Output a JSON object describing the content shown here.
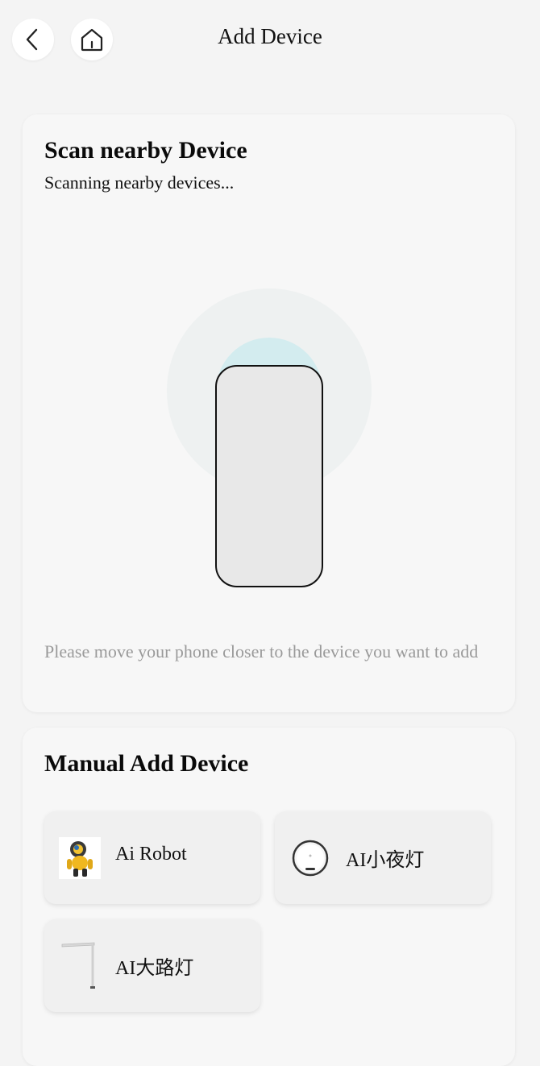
{
  "header": {
    "title": "Add Device",
    "back_icon": "chevron-left-icon",
    "home_icon": "home-icon"
  },
  "scan": {
    "title": "Scan nearby Device",
    "status": "Scanning nearby devices...",
    "hint": "Please move your phone closer to the device you want to add",
    "radar_color": "#cfe9ec"
  },
  "manual": {
    "title": "Manual Add Device",
    "devices": [
      {
        "label": "Ai Robot",
        "icon": "robot-icon"
      },
      {
        "label": "AI小夜灯",
        "icon": "night-light-icon"
      },
      {
        "label": "AI大路灯",
        "icon": "floor-lamp-icon"
      }
    ]
  }
}
